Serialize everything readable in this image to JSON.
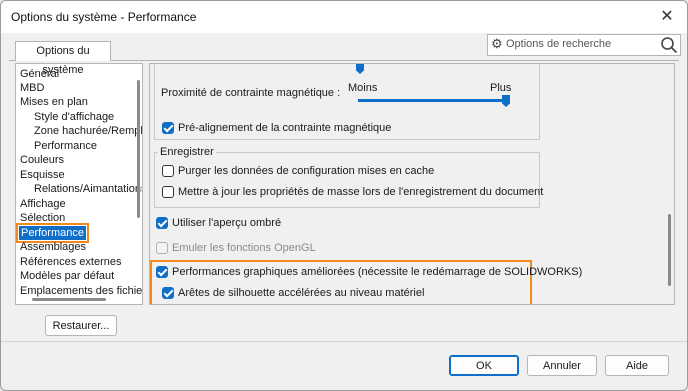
{
  "window": {
    "title": "Options du système - Performance"
  },
  "tab": {
    "label": "Options du système"
  },
  "search": {
    "placeholder": "Options de recherche"
  },
  "tree": {
    "items": [
      {
        "label": "Général",
        "level": 0
      },
      {
        "label": "MBD",
        "level": 0
      },
      {
        "label": "Mises en plan",
        "level": 0
      },
      {
        "label": "Style d'affichage",
        "level": 1
      },
      {
        "label": "Zone hachurée/Remplissage",
        "level": 1
      },
      {
        "label": "Performance",
        "level": 1
      },
      {
        "label": "Couleurs",
        "level": 0
      },
      {
        "label": "Esquisse",
        "level": 0
      },
      {
        "label": "Relations/Aimantations",
        "level": 1
      },
      {
        "label": "Affichage",
        "level": 0
      },
      {
        "label": "Sélection",
        "level": 0
      },
      {
        "label": "Performance",
        "level": 0,
        "selected": true
      },
      {
        "label": "Assemblages",
        "level": 0
      },
      {
        "label": "Références externes",
        "level": 0
      },
      {
        "label": "Modèles par défaut",
        "level": 0
      },
      {
        "label": "Emplacements des fichiers",
        "level": 0
      }
    ]
  },
  "panel": {
    "snap_label": "Proximité de contrainte magnétique :",
    "slider_min": "Moins",
    "slider_max": "Plus",
    "slider_value": 1.0,
    "prealign_label": "Pré-alignement de la contrainte magnétique",
    "prealign_checked": true,
    "save_group_label": "Enregistrer",
    "purge_label": "Purger les données de configuration mises en cache",
    "purge_checked": false,
    "mass_label": "Mettre à jour les propriétés de masse lors de l'enregistrement du document",
    "mass_checked": false,
    "shaded_preview_label": "Utiliser l'aperçu ombré",
    "shaded_preview_checked": true,
    "opengl_label": "Emuler les fonctions OpenGL",
    "opengl_checked": false,
    "enhanced_gfx_label": "Performances graphiques améliorées (nécessite le redémarrage de SOLIDWORKS)",
    "enhanced_gfx_checked": true,
    "silhouette_label": "Arêtes de silhouette accélérées au niveau matériel",
    "silhouette_checked": true
  },
  "buttons": {
    "restore": "Restaurer...",
    "ok": "OK",
    "cancel": "Annuler",
    "help": "Aide"
  },
  "colors": {
    "accent": "#0f6fc8",
    "highlight": "#f08a1c"
  }
}
